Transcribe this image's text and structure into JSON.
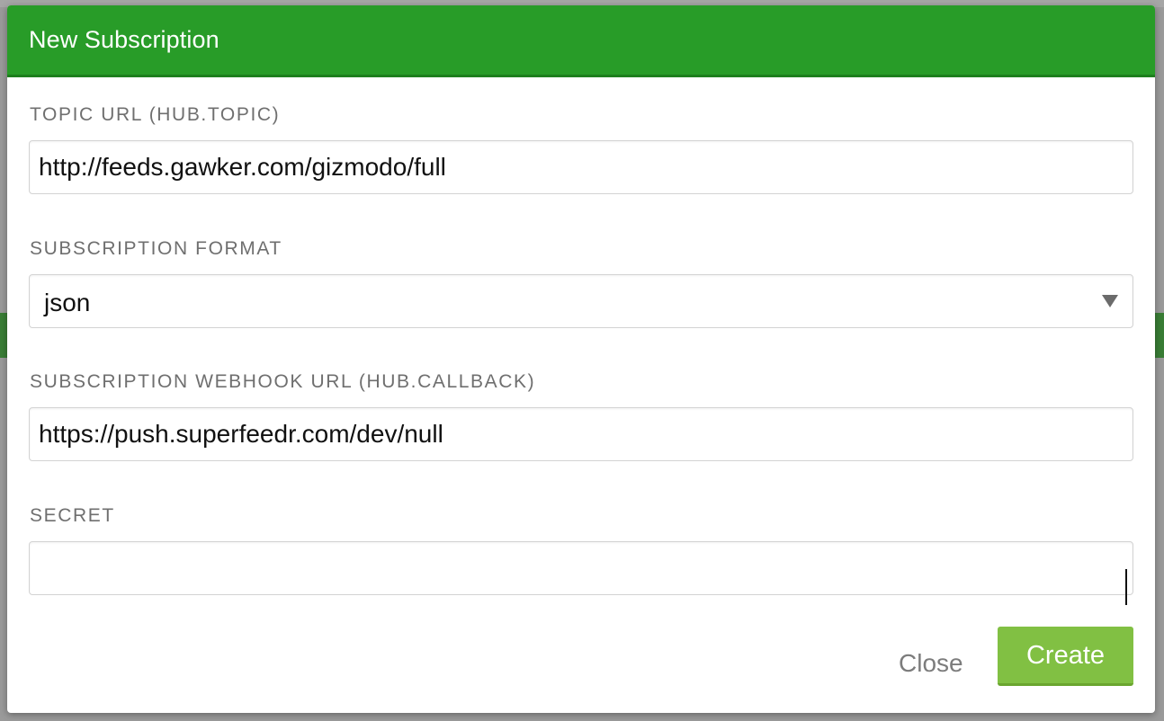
{
  "modal": {
    "title": "New Subscription",
    "topic": {
      "label": "TOPIC URL (HUB.TOPIC)",
      "value": "http://feeds.gawker.com/gizmodo/full"
    },
    "format": {
      "label": "SUBSCRIPTION FORMAT",
      "selected": "json"
    },
    "callback": {
      "label": "SUBSCRIPTION WEBHOOK URL (HUB.CALLBACK)",
      "value": "https://push.superfeedr.com/dev/null"
    },
    "secret": {
      "label": "SECRET",
      "value": ""
    },
    "close_label": "Close",
    "create_label": "Create"
  },
  "colors": {
    "header": "#289c28",
    "create_button": "#81c043",
    "label_text": "#6f6f6f"
  },
  "icons": {
    "select_caret": "caret-down-icon"
  }
}
